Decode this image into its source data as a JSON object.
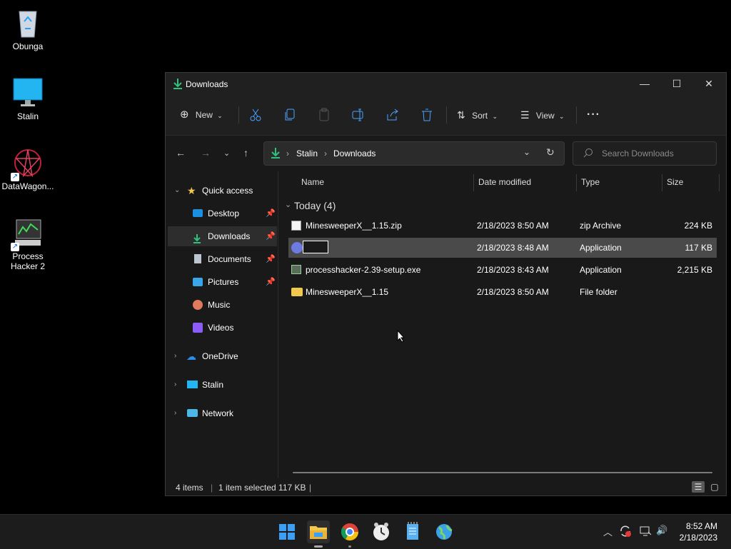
{
  "desktop": {
    "icons": [
      {
        "label": "Obunga"
      },
      {
        "label": "Stalin"
      },
      {
        "label": "DataWagon..."
      },
      {
        "label": "Process Hacker 2"
      }
    ]
  },
  "window": {
    "title": "Downloads",
    "toolbar": {
      "new_label": "New",
      "sort_label": "Sort",
      "view_label": "View",
      "more": "···"
    },
    "address": {
      "root": "Stalin",
      "current": "Downloads"
    },
    "search": {
      "placeholder": "Search Downloads"
    },
    "sidebar": {
      "quick_access": "Quick access",
      "items": [
        {
          "label": "Desktop"
        },
        {
          "label": "Downloads"
        },
        {
          "label": "Documents"
        },
        {
          "label": "Pictures"
        },
        {
          "label": "Music"
        },
        {
          "label": "Videos"
        }
      ],
      "onedrive": "OneDrive",
      "stalin": "Stalin",
      "network": "Network"
    },
    "columns": {
      "name": "Name",
      "date": "Date modified",
      "type": "Type",
      "size": "Size"
    },
    "group": "Today (4)",
    "files": [
      {
        "name": "MinesweeperX__1.15.zip",
        "date": "2/18/2023 8:50 AM",
        "type": "zip Archive",
        "size": "224 KB"
      },
      {
        "name": "",
        "date": "2/18/2023 8:48 AM",
        "type": "Application",
        "size": "117 KB"
      },
      {
        "name": "processhacker-2.39-setup.exe",
        "date": "2/18/2023 8:43 AM",
        "type": "Application",
        "size": "2,215 KB"
      },
      {
        "name": "MinesweeperX__1.15",
        "date": "2/18/2023 8:50 AM",
        "type": "File folder",
        "size": ""
      }
    ],
    "status": {
      "count": "4 items",
      "selected": "1 item selected 117 KB"
    }
  },
  "taskbar": {
    "time": "8:52 AM",
    "date": "2/18/2023"
  },
  "colors": {
    "folder": "#f2c94c",
    "accent": "#1aa35a",
    "selection": "#4a4a4a"
  }
}
